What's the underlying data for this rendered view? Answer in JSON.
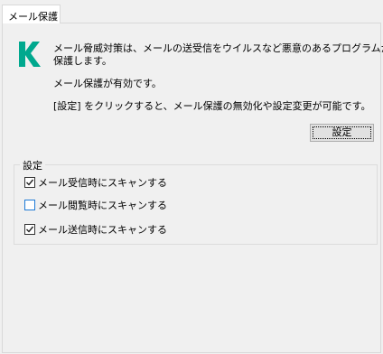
{
  "tab": {
    "label": "メール保護"
  },
  "info": {
    "line1": "メール脅威対策は、メールの送受信をウイルスなど悪意のあるプログラムから",
    "line2": "保護します。",
    "status": "メール保護が有効です。",
    "hint": "[設定] をクリックすると、メール保護の無効化や設定変更が可能です。"
  },
  "settings_button": {
    "label": "設定"
  },
  "settings_group": {
    "label": "設定",
    "options": [
      {
        "label": "メール受信時にスキャンする",
        "checked": true
      },
      {
        "label": "メール閲覧時にスキャンする",
        "checked": false
      },
      {
        "label": "メール送信時にスキャンする",
        "checked": true
      }
    ]
  },
  "colors": {
    "logo": "#00a88e",
    "checkbox_focus": "#1e7ad6"
  },
  "icons": {
    "logo": "kaspersky-k-logo-icon",
    "check": "checkmark-icon"
  }
}
